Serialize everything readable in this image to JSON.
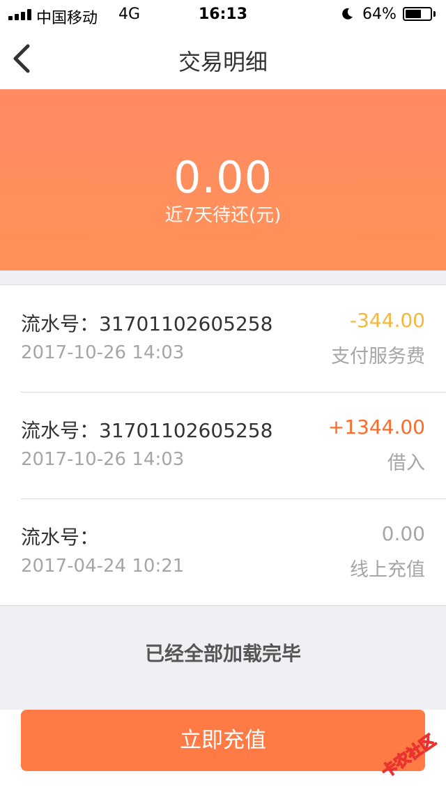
{
  "status_bar": {
    "carrier": "中国移动",
    "network": "4G",
    "time": "16:13",
    "battery": "64%",
    "battery_level": 0.64
  },
  "nav": {
    "title": "交易明细"
  },
  "summary": {
    "amount": "0.00",
    "label": "近7天待还(元)"
  },
  "transactions": [
    {
      "serial": "流水号：31701102605258",
      "date": "2017-10-26 14:03",
      "amount": "-344.00",
      "type": "支付服务费",
      "amount_color": "#f5b83d"
    },
    {
      "serial": "流水号：31701102605258",
      "date": "2017-10-26 14:03",
      "amount": "+1344.00",
      "type": "借入",
      "amount_color": "#ff6a2b"
    },
    {
      "serial": "流水号：",
      "date": "2017-04-24 10:21",
      "amount": "0.00",
      "type": "线上充值",
      "amount_color": "#a6a6a6"
    }
  ],
  "footer_text": "已经全部加载完毕",
  "recharge_button": "立即充值",
  "watermark_text": "卡农社区",
  "colors": {
    "banner": "#ff8a63",
    "button": "#ff7a44"
  }
}
